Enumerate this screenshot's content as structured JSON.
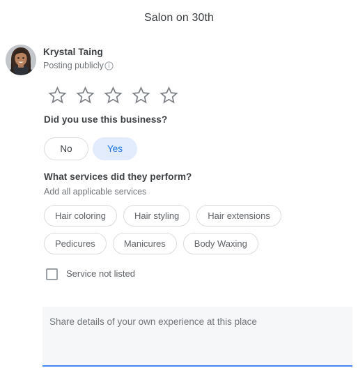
{
  "dialog": {
    "title": "Salon on 30th"
  },
  "author": {
    "name": "Krystal Taing",
    "visibility": "Posting publicly",
    "info_icon": "info-circle-icon",
    "avatar_icon": "user-avatar-photo"
  },
  "rating": {
    "max": 5,
    "value": 0,
    "star_icon": "star-outline-icon",
    "stars": [
      {
        "index": 1,
        "filled": false
      },
      {
        "index": 2,
        "filled": false
      },
      {
        "index": 3,
        "filled": false
      },
      {
        "index": 4,
        "filled": false
      },
      {
        "index": 5,
        "filled": false
      }
    ]
  },
  "used_business": {
    "question": "Did you use this business?",
    "options": [
      {
        "label": "No",
        "selected": false
      },
      {
        "label": "Yes",
        "selected": true
      }
    ]
  },
  "services": {
    "question": "What services did they perform?",
    "subtitle": "Add all applicable services",
    "chips": [
      {
        "label": "Hair coloring",
        "selected": false
      },
      {
        "label": "Hair styling",
        "selected": false
      },
      {
        "label": "Hair extensions",
        "selected": false
      },
      {
        "label": "Pedicures",
        "selected": false
      },
      {
        "label": "Manicures",
        "selected": false
      },
      {
        "label": "Body Waxing",
        "selected": false
      }
    ],
    "not_listed": {
      "label": "Service not listed",
      "checked": false
    }
  },
  "review": {
    "placeholder": "Share details of your own experience at this place",
    "value": ""
  },
  "colors": {
    "accent_blue": "#1a73e8",
    "selected_chip_bg": "#e3ecfd",
    "underline_blue": "#4285f4",
    "text_primary": "#3c4043",
    "text_secondary": "#70757a",
    "border_gray": "#dadce0",
    "textarea_bg": "#f6f7f8",
    "star_gray": "#7b7f84"
  }
}
